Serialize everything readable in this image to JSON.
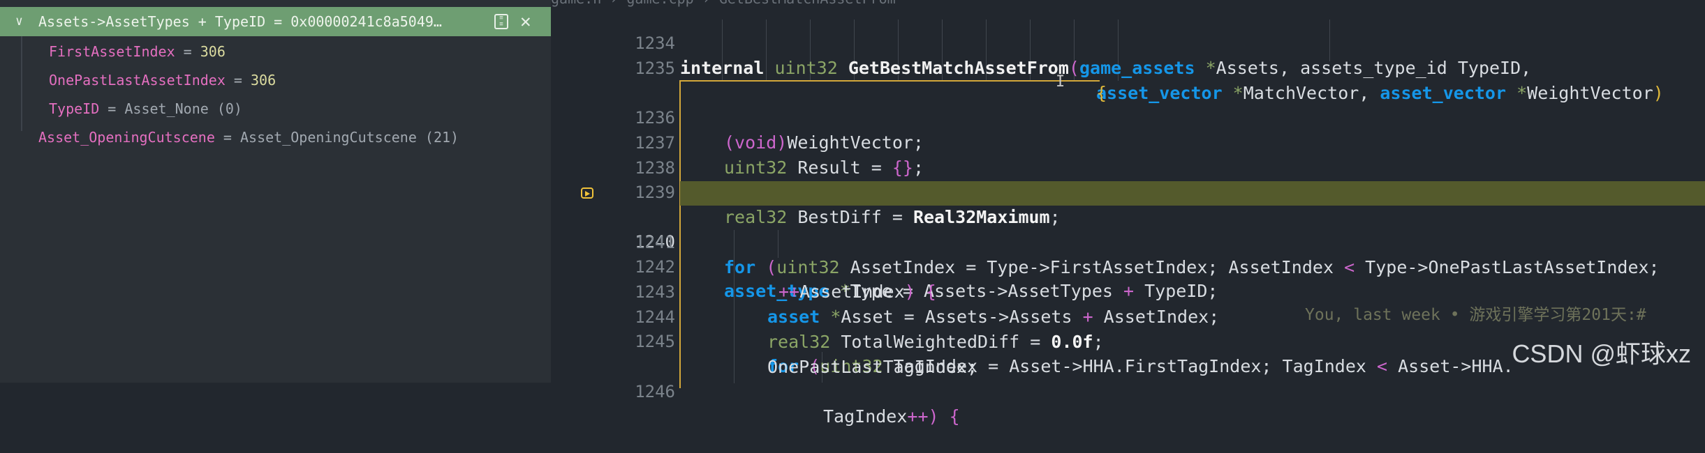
{
  "watch": {
    "expression": "Assets->AssetTypes + TypeID = 0x00000241c8a5049…",
    "children": [
      {
        "name": "FirstAssetIndex",
        "value": "306"
      },
      {
        "name": "OnePastLastAssetIndex",
        "value": "306"
      },
      {
        "name": "TypeID",
        "value": "Asset_None (0)"
      }
    ],
    "item2": {
      "name": "Asset_OpeningCutscene",
      "value": "Asset_OpeningCutscene (21)"
    }
  },
  "editor": {
    "breadcrumb": "game.h  ›  game.cpp  ›  GetBestMatchAssetFrom",
    "current_line": "1240",
    "blame": "You, last week • 游戏引擎学习第201天:#",
    "lines": {
      "l1234": {
        "n": "1234",
        "a": "internal ",
        "b": "uint32 ",
        "c": "GetBestMatchAssetFrom",
        "d": "(",
        "e": "game_assets ",
        "f": "*",
        "g": "Assets, assets_type_id TypeID,"
      },
      "l1235": {
        "n": "1235",
        "a": "asset_vector ",
        "b": "*",
        "c": "MatchVector, ",
        "d": "asset_vector ",
        "e": "*",
        "f": "WeightVector",
        "g": ")"
      },
      "l1235b": {
        "a": "{"
      },
      "l1236": {
        "n": "1236",
        "a": "(void)",
        "b": "WeightVector;"
      },
      "l1237": {
        "n": "1237",
        "a": "uint32 ",
        "b": "Result = ",
        "c": "{}",
        "d": ";"
      },
      "l1238": {
        "n": "1238"
      },
      "l1239": {
        "n": "1239",
        "a": "real32 ",
        "b": "BestDiff = ",
        "c": "Real32Maximum",
        "d": ";"
      },
      "l1240": {
        "n": "1240",
        "a": "asset_type ",
        "b": "*",
        "c": "Type = Assets->AssetTypes ",
        "d": "+",
        "e": " TypeID;"
      },
      "l1241": {
        "n": "1241",
        "a": "for ",
        "b": "(",
        "c": "uint32 ",
        "d": "AssetIndex = Type->FirstAssetIndex; AssetIndex ",
        "e": "<",
        "f": " Type->OnePastLastAssetIndex;"
      },
      "l1242": {
        "n": "1242",
        "a": "++",
        "b": "AssetIndex",
        "c": ")",
        "d": " {"
      },
      "l1243": {
        "n": "1243",
        "a": "asset ",
        "b": "*",
        "c": "Asset = Assets->Assets ",
        "d": "+",
        "e": " AssetIndex;"
      },
      "l1244": {
        "n": "1244",
        "a": "real32 ",
        "b": "TotalWeightedDiff = ",
        "c": "0.0f",
        "d": ";"
      },
      "l1245": {
        "n": "1245",
        "a": "for ",
        "b": "(",
        "c": "uint32 ",
        "d": "TagIndex = Asset->HHA.FirstTagIndex; TagIndex ",
        "e": "<",
        "f": " Asset->HHA."
      },
      "l1245b": {
        "a": "OnePastLastTagIndex;"
      },
      "l1246": {
        "n": "1246",
        "a": "TagIndex",
        "b": "++",
        "c": ")",
        "d": " {"
      }
    }
  },
  "watermark": "CSDN @虾球xz"
}
